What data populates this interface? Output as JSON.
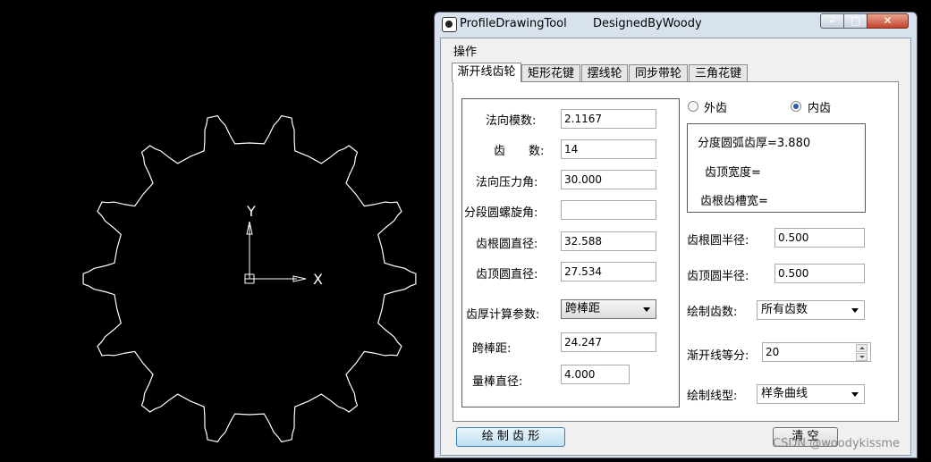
{
  "window": {
    "app_name": "ProfileDrawingTool",
    "designer": "DesignedByWoody",
    "minimize_glyph": "–",
    "maximize_glyph": "□",
    "close_glyph": "✕"
  },
  "menu": {
    "operate": "操作"
  },
  "tabs": [
    "渐开线齿轮",
    "矩形花键",
    "摆线轮",
    "同步带轮",
    "三角花键"
  ],
  "params": {
    "normal_module": {
      "label": "法向模数:",
      "value": "2.1167"
    },
    "teeth": {
      "label": "齿　　数:",
      "value": "14"
    },
    "pressure_angle": {
      "label": "法向压力角:",
      "value": "30.000"
    },
    "helix_angle": {
      "label": "分段圆螺旋角:",
      "value": ""
    },
    "root_dia": {
      "label": "齿根圆直径:",
      "value": "32.588"
    },
    "tip_dia": {
      "label": "齿顶圆直径:",
      "value": "27.534"
    },
    "thickness_param": {
      "label": "齿厚计算参数:",
      "value": "跨棒距"
    },
    "over_pins": {
      "label": "跨棒距:",
      "value": "24.247"
    },
    "pin_dia": {
      "label": "量棒直径:",
      "value": "4.000"
    }
  },
  "gear_type": {
    "external": "外齿",
    "internal": "内齿",
    "selected": "internal"
  },
  "info": {
    "arc_thickness": "分度圆弧齿厚=3.880",
    "tip_width": "齿顶宽度=",
    "root_width": "齿根齿槽宽="
  },
  "right": {
    "root_fillet": {
      "label": "齿根圆半径:",
      "value": "0.500"
    },
    "tip_fillet": {
      "label": "齿顶圆半径:",
      "value": "0.500"
    },
    "draw_teeth": {
      "label": "绘制齿数:",
      "value": "所有齿数"
    },
    "involute_div": {
      "label": "渐开线等分:",
      "value": "20"
    },
    "line_type": {
      "label": "绘制线型:",
      "value": "样条曲线"
    }
  },
  "buttons": {
    "draw": "绘 制 齿 形",
    "clear": "清 空"
  },
  "cad": {
    "y_axis": "Y",
    "x_axis": "X",
    "teeth_count": 14
  },
  "watermark": "CSDN @woodykissme"
}
